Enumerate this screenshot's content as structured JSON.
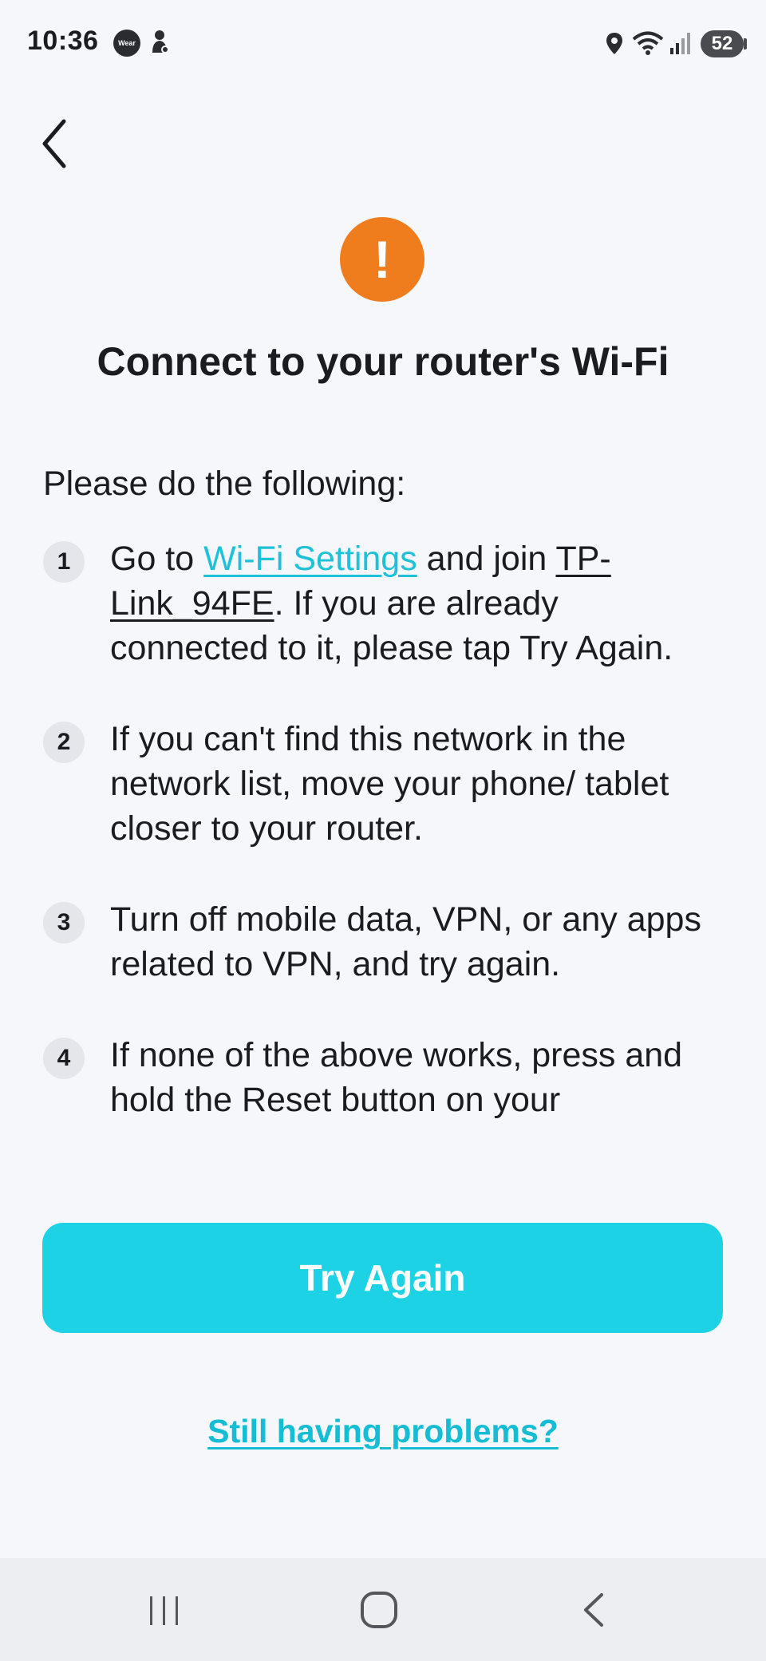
{
  "status_bar": {
    "time": "10:36",
    "wear_label": "Wear",
    "battery": "52",
    "icons": [
      "wear-icon",
      "notification-icon",
      "location-icon",
      "wifi-icon",
      "signal-icon",
      "battery-icon"
    ]
  },
  "header": {
    "back_icon": "chevron-left-icon",
    "alert_icon": "exclamation-icon",
    "alert_symbol": "!",
    "title": "Connect to your router's Wi-Fi"
  },
  "instructions": {
    "intro": "Please do the following:",
    "steps": [
      {
        "number": "1",
        "text_before_link": "Go to ",
        "link": "Wi-Fi Settings",
        "text_after_link": " and join ",
        "network": "TP-Link_94FE",
        "text_end": ". If you are already connected to it, please tap Try Again."
      },
      {
        "number": "2",
        "text": "If you can't find this network in the network list, move your phone/ tablet closer to your router."
      },
      {
        "number": "3",
        "text": "Turn off mobile data, VPN, or any apps related to VPN, and try again."
      },
      {
        "number": "4",
        "text": "If none of the above works, press and hold the Reset button on your"
      }
    ]
  },
  "actions": {
    "primary": "Try Again",
    "help": "Still having problems?"
  },
  "nav_bar": {
    "icons": [
      "recents-icon",
      "home-icon",
      "back-icon"
    ]
  },
  "colors": {
    "accent": "#1ed2e6",
    "link": "#1ec2d8",
    "warning": "#ef7d1d",
    "background": "#f5f7fb"
  }
}
